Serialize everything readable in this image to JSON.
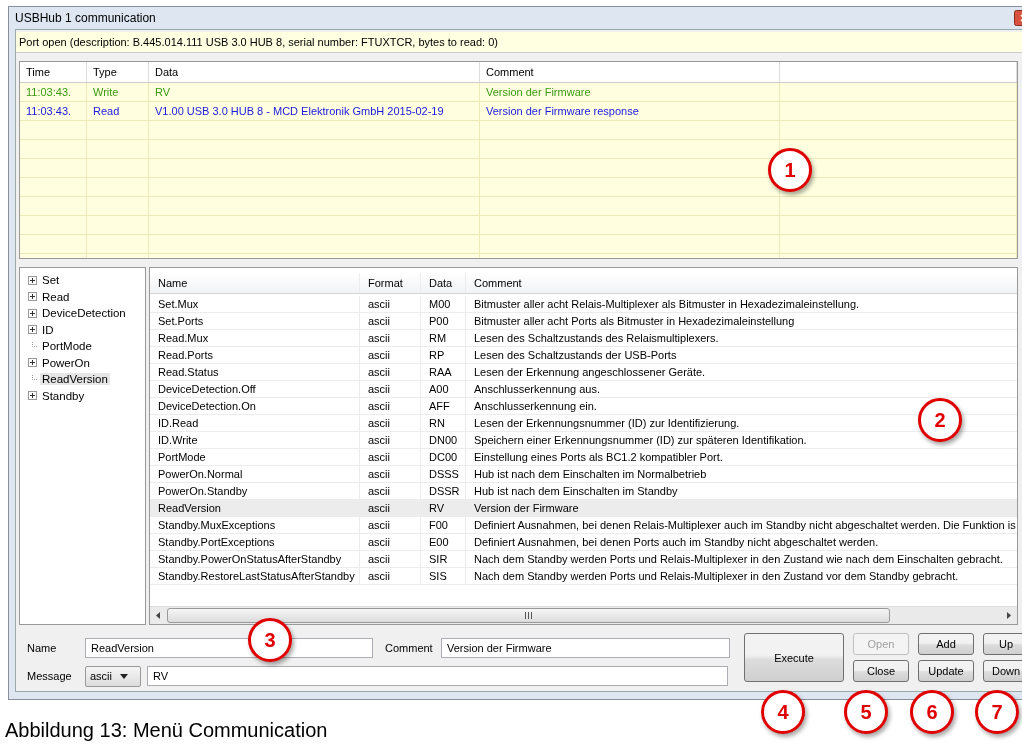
{
  "window": {
    "title": "USBHub 1 communication"
  },
  "status": "Port open (description: B.445.014.111 USB 3.0 HUB 8, serial number: FTUXTCR, bytes to read: 0)",
  "log": {
    "columns": [
      "Time",
      "Type",
      "Data",
      "Comment"
    ],
    "rows": [
      {
        "kind": "write",
        "time": "11:03:43.",
        "type": "Write",
        "data": "RV",
        "comment": "Version der Firmware"
      },
      {
        "kind": "read",
        "time": "11:03:43.",
        "type": "Read",
        "data": "V1.00 USB 3.0 HUB 8 - MCD Elektronik GmbH 2015-02-19",
        "comment": "Version der Firmware response"
      }
    ]
  },
  "tree": [
    {
      "label": "Set",
      "expandable": true,
      "selected": false
    },
    {
      "label": "Read",
      "expandable": true,
      "selected": false
    },
    {
      "label": "DeviceDetection",
      "expandable": true,
      "selected": false
    },
    {
      "label": "ID",
      "expandable": true,
      "selected": false
    },
    {
      "label": "PortMode",
      "expandable": false,
      "selected": false
    },
    {
      "label": "PowerOn",
      "expandable": true,
      "selected": false
    },
    {
      "label": "ReadVersion",
      "expandable": false,
      "selected": true
    },
    {
      "label": "Standby",
      "expandable": true,
      "selected": false
    }
  ],
  "commands": {
    "columns": [
      "Name",
      "Format",
      "Data",
      "Comment"
    ],
    "rows": [
      {
        "name": "Set.Mux",
        "format": "ascii",
        "data": "M00",
        "comment": "Bitmuster aller acht Relais-Multiplexer als Bitmuster in Hexadezimaleinstellung.",
        "selected": false
      },
      {
        "name": "Set.Ports",
        "format": "ascii",
        "data": "P00",
        "comment": "Bitmuster aller acht Ports als Bitmuster in Hexadezimaleinstellung",
        "selected": false
      },
      {
        "name": "Read.Mux",
        "format": "ascii",
        "data": "RM",
        "comment": "Lesen des Schaltzustands  des Relaismultiplexers.",
        "selected": false
      },
      {
        "name": "Read.Ports",
        "format": "ascii",
        "data": "RP",
        "comment": "Lesen des Schaltzustands  der USB-Ports",
        "selected": false
      },
      {
        "name": "Read.Status",
        "format": "ascii",
        "data": "RAA",
        "comment": "Lesen der Erkennung angeschlossener Geräte.",
        "selected": false
      },
      {
        "name": "DeviceDetection.Off",
        "format": "ascii",
        "data": "A00",
        "comment": "Anschlusserkennung aus.",
        "selected": false
      },
      {
        "name": "DeviceDetection.On",
        "format": "ascii",
        "data": "AFF",
        "comment": "Anschlusserkennung ein.",
        "selected": false
      },
      {
        "name": "ID.Read",
        "format": "ascii",
        "data": "RN",
        "comment": "Lesen der Erkennungsnummer (ID) zur Identifizierung.",
        "selected": false
      },
      {
        "name": "ID.Write",
        "format": "ascii",
        "data": "DN00",
        "comment": "Speichern einer Erkennungsnummer (ID) zur späteren Identifikation.",
        "selected": false
      },
      {
        "name": "PortMode",
        "format": "ascii",
        "data": "DC00",
        "comment": "Einstellung eines Ports als BC1.2 kompatibler Port.",
        "selected": false
      },
      {
        "name": "PowerOn.Normal",
        "format": "ascii",
        "data": "DSSS",
        "comment": "Hub ist nach dem Einschalten im Normalbetrieb",
        "selected": false
      },
      {
        "name": "PowerOn.Standby",
        "format": "ascii",
        "data": "DSSR",
        "comment": "Hub ist nach dem Einschalten im Standby",
        "selected": false
      },
      {
        "name": "ReadVersion",
        "format": "ascii",
        "data": "RV",
        "comment": "Version der Firmware",
        "selected": true
      },
      {
        "name": "Standby.MuxExceptions",
        "format": "ascii",
        "data": "F00",
        "comment": "Definiert Ausnahmen, bei denen Relais-Multiplexer auch im Standby nicht abgeschaltet werden. Die Funktion is",
        "selected": false
      },
      {
        "name": "Standby.PortExceptions",
        "format": "ascii",
        "data": "E00",
        "comment": "Definiert Ausnahmen, bei denen Ports auch im Standby nicht abgeschaltet werden.",
        "selected": false
      },
      {
        "name": "Standby.PowerOnStatusAfterStandby",
        "format": "ascii",
        "data": "SIR",
        "comment": "Nach dem Standby werden Ports und Relais-Multiplexer in den Zustand wie nach dem Einschalten gebracht.",
        "selected": false
      },
      {
        "name": "Standby.RestoreLastStatusAfterStandby",
        "format": "ascii",
        "data": "SIS",
        "comment": "Nach dem Standby werden Ports und Relais-Multiplexer in den Zustand vor dem Standby gebracht.",
        "selected": false
      }
    ]
  },
  "form": {
    "name_label": "Name",
    "name_value": "ReadVersion",
    "comment_label": "Comment",
    "comment_value": "Version der Firmware",
    "message_label": "Message",
    "format_value": "ascii",
    "message_value": "RV"
  },
  "buttons": [
    {
      "label": "Execute",
      "disabled": false
    },
    {
      "label": "Open",
      "disabled": true
    },
    {
      "label": "Close",
      "disabled": false
    },
    {
      "label": "Add",
      "disabled": false
    },
    {
      "label": "Update",
      "disabled": false
    },
    {
      "label": "Up",
      "disabled": false
    },
    {
      "label": "Down",
      "disabled": false
    }
  ],
  "callouts": [
    "1",
    "2",
    "3",
    "4",
    "5",
    "6",
    "7"
  ],
  "caption": "Abbildung 13: Menü Communication"
}
